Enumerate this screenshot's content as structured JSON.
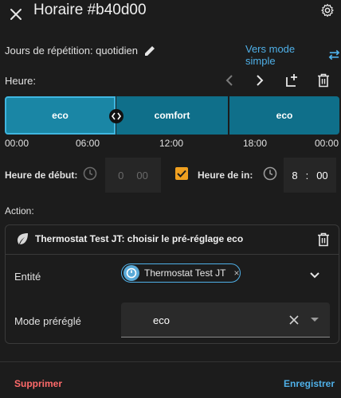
{
  "header": {
    "title": "Horaire #b40d00",
    "close_icon": "close-icon",
    "settings_icon": "gear-icon"
  },
  "repeat": {
    "label": "Jours de répétition: quotidien",
    "edit_icon": "pencil-icon",
    "simple_mode_label": "Vers mode simple",
    "simple_mode_icon": "swap-horizontal-icon"
  },
  "timeline": {
    "label": "Heure:",
    "toolbar_icons": [
      "chevron-left-icon",
      "chevron-right-icon",
      "add-slot-icon",
      "trash-icon"
    ],
    "slots": [
      {
        "label": "eco",
        "selected": true
      },
      {
        "label": "comfort",
        "selected": false
      },
      {
        "label": "eco",
        "selected": false
      }
    ],
    "ticks": [
      "00:00",
      "06:00",
      "12:00",
      "18:00",
      "00:00"
    ]
  },
  "start_time": {
    "label": "Heure de début:",
    "hours": "0",
    "minutes": "00"
  },
  "end_time": {
    "checked": true,
    "label": "Heure de in:",
    "hours": "8",
    "separator": ":",
    "minutes": "00"
  },
  "action": {
    "label": "Action:",
    "card_title": "Thermostat Test JT: choisir le pré-réglage eco",
    "entity_label": "Entité",
    "entity_value": "Thermostat Test JT",
    "entity_remove": "×",
    "preset_label": "Mode préréglé",
    "preset_value": "eco"
  },
  "footer": {
    "delete_label": "Supprimer",
    "save_label": "Enregistrer"
  },
  "colors": {
    "accent": "#4fb0e8",
    "slot": "#0f6f8a",
    "danger": "#ff6a6a",
    "checkbox": "#f0a020"
  }
}
